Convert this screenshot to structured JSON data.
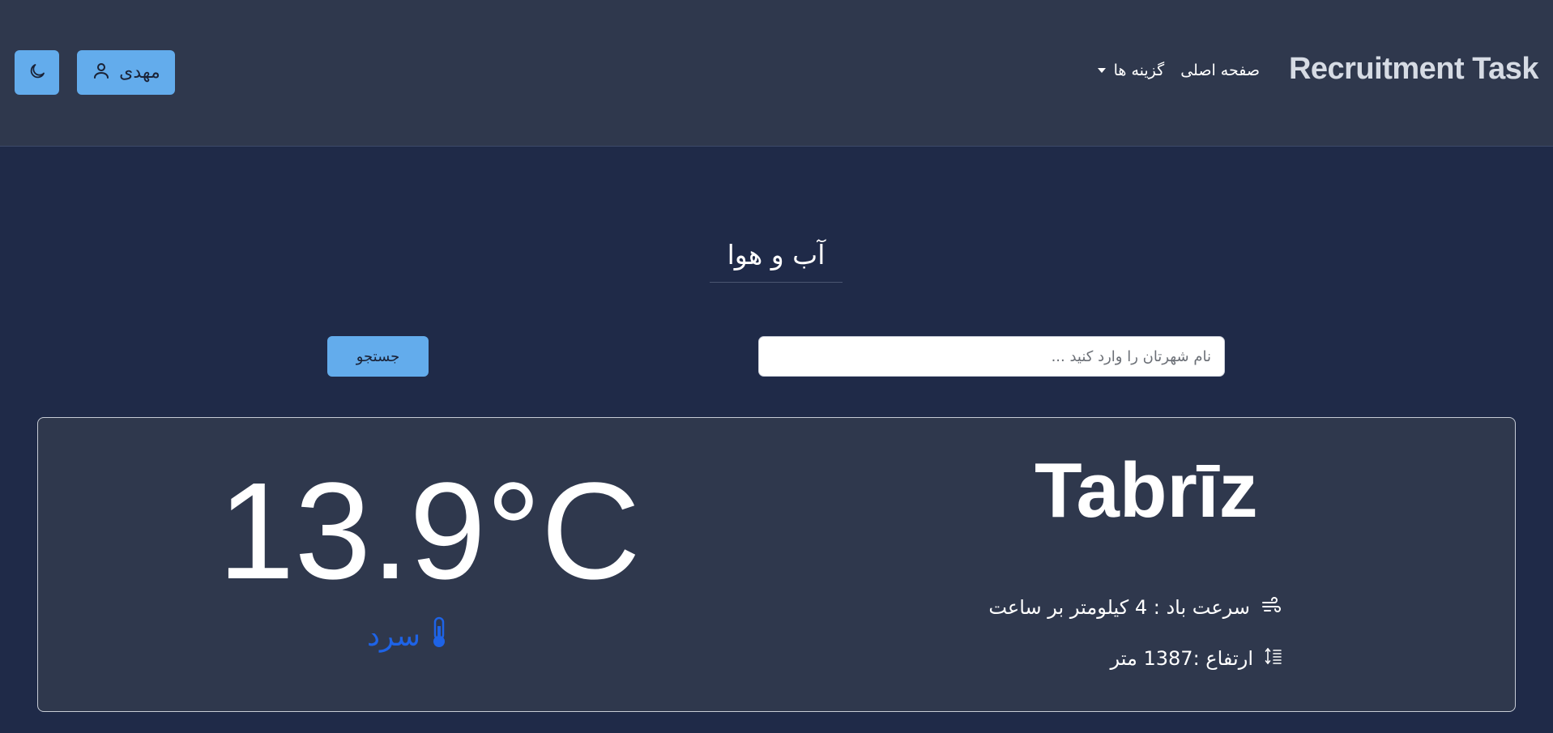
{
  "header": {
    "brand": "Recruitment Task",
    "nav": {
      "home": "صفحه اصلی",
      "options": "گزینه ها"
    },
    "user_label": "مهدی",
    "icons": {
      "user": "user-icon",
      "theme": "moon-icon",
      "dropdown": "caret-down-icon"
    }
  },
  "page": {
    "title": "آب و هوا"
  },
  "search": {
    "placeholder": "نام شهرتان را وارد کنید ...",
    "value": "",
    "button_label": "جستجو"
  },
  "weather": {
    "temperature": "13.9°C",
    "condition": "سرد",
    "condition_color": "#1e63e6",
    "condition_icon": "thermometer-icon",
    "city": "Tabrīz",
    "wind_label": "سرعت باد : 4 کیلومتر بر ساعت",
    "wind_icon": "wind-icon",
    "altitude_label": "ارتفاع :1387 متر",
    "altitude_icon": "altitude-icon"
  },
  "colors": {
    "background": "#1f2a48",
    "header": "#2f384d",
    "card": "#2f384d",
    "accent": "#63acec"
  }
}
